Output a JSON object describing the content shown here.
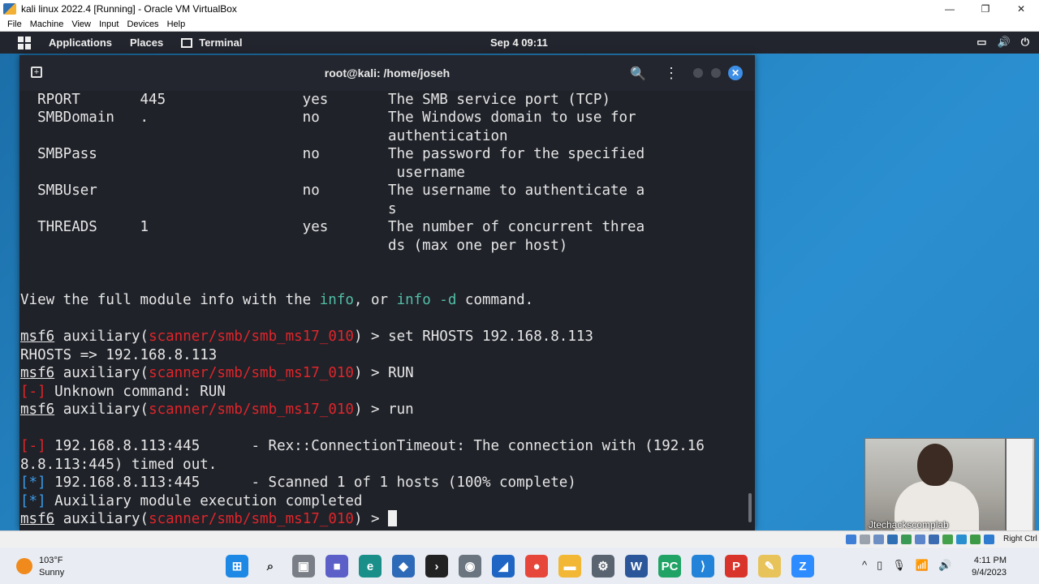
{
  "host_window": {
    "title": "kali linux 2022.4 [Running] - Oracle VM VirtualBox",
    "menu": [
      "File",
      "Machine",
      "View",
      "Input",
      "Devices",
      "Help"
    ],
    "minimize": "—",
    "maximize": "❐",
    "close": "✕"
  },
  "kali_panel": {
    "applications": "Applications",
    "places": "Places",
    "terminal": "Terminal",
    "clock": "Sep 4  09:11",
    "tray": [
      "▭",
      "🔊",
      "⏻"
    ]
  },
  "terminal": {
    "title": "root@kali: /home/joseh",
    "new_tab_icon": "+",
    "search_icon": "🔍",
    "menu_icon": "⋮",
    "close_icon": "✕",
    "lines": {
      "l1": "  RPORT       445                yes       The SMB service port (TCP)",
      "l2": "  SMBDomain   .                  no        The Windows domain to use for",
      "l3": "                                           authentication",
      "l4": "  SMBPass                        no        The password for the specified",
      "l5": "                                            username",
      "l6": "  SMBUser                        no        The username to authenticate a",
      "l7": "                                           s",
      "l8": "  THREADS     1                  yes       The number of concurrent threa",
      "l9": "                                           ds (max one per host)",
      "view_a": "View the full module info with the ",
      "view_info": "info",
      "view_b": ", or ",
      "view_info_d": "info -d",
      "view_c": " command.",
      "prompt_msf": "msf6",
      "prompt_aux": " auxiliary(",
      "prompt_mod": "scanner/smb/smb_ms17_010",
      "prompt_end": ") > ",
      "cmd1": "set RHOSTS 192.168.8.113",
      "out1": "RHOSTS => 192.168.8.113",
      "cmd2": "RUN",
      "err_tag": "[-]",
      "out2": " Unknown command: RUN",
      "cmd3": "run",
      "out3": " 192.168.8.113:445      - Rex::ConnectionTimeout: The connection with (192.16",
      "out4": "8.8.113:445) timed out.",
      "info_tag": "[*]",
      "out5": " 192.168.8.113:445      - Scanned 1 of 1 hosts (100% complete)",
      "out6": " Auxiliary module execution completed"
    }
  },
  "webcam": {
    "label": "Jtechackscomplab"
  },
  "vb_status": {
    "host_key": "Right Ctrl"
  },
  "taskbar": {
    "weather_temp": "103°F",
    "weather_desc": "Sunny",
    "time": "4:11 PM",
    "date": "9/4/2023",
    "tray": [
      "^",
      "▯",
      "🎙",
      "📶",
      "🔊"
    ]
  },
  "colors": {
    "terminal_bg": "#1f2229",
    "prompt_red": "#e0252a",
    "info_blue": "#3b9ae8",
    "cmd_teal": "#53bfa6",
    "close_blue": "#3d8ee6"
  }
}
